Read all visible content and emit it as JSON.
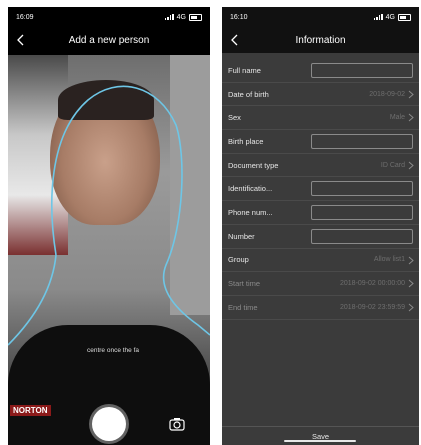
{
  "left_screen": {
    "status": {
      "time": "16:09",
      "network": "4G"
    },
    "title": "Add a new person",
    "hint": "centre once the fa",
    "brand": "NORTON"
  },
  "right_screen": {
    "status": {
      "time": "16:10",
      "network": "4G"
    },
    "title": "Information",
    "rows": [
      {
        "label": "Full name",
        "type": "input",
        "value": ""
      },
      {
        "label": "Date of birth",
        "type": "select",
        "value": "2018-09-02"
      },
      {
        "label": "Sex",
        "type": "select",
        "value": "Male"
      },
      {
        "label": "Birth place",
        "type": "input",
        "value": ""
      },
      {
        "label": "Document type",
        "type": "select",
        "value": "ID Card"
      },
      {
        "label": "Identificatio...",
        "type": "input",
        "value": ""
      },
      {
        "label": "Phone num...",
        "type": "input",
        "value": ""
      },
      {
        "label": "Number",
        "type": "input",
        "value": ""
      },
      {
        "label": "Group",
        "type": "select",
        "value": "Allow list1"
      },
      {
        "label": "Start time",
        "type": "select",
        "value": "2018-09-02 00:00:00",
        "dim": true
      },
      {
        "label": "End time",
        "type": "select",
        "value": "2018-09-02 23:59:59",
        "dim": true
      }
    ],
    "save_label": "Save"
  }
}
